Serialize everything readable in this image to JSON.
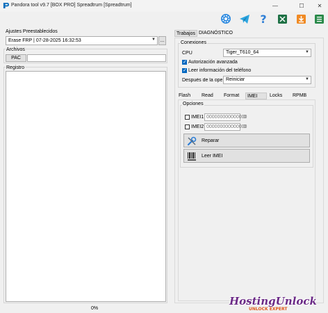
{
  "window": {
    "title": "Pandora tool v9.7 [BOX PRO] Spreadtrum [Spreadtrum]",
    "minimize": "—",
    "maximize": "☐",
    "close": "✕"
  },
  "toolbar": {
    "icons": [
      "gear-icon",
      "telegram-icon",
      "help-icon",
      "excel-icon",
      "download-icon",
      "menu-icon"
    ]
  },
  "left": {
    "presets_label": "Ajustes Preestablecidos",
    "preset_value": "Erase FRP | 07-28-2025 16:32:53",
    "preset_button": "...",
    "files_label": "Archivos",
    "pac_button": "PAC",
    "log_label": "Registro",
    "progress": "0%"
  },
  "right": {
    "tabs": [
      "Trabajos",
      "DIAGNÓSTICO"
    ],
    "connections_label": "Conexiones",
    "cpu_label": "CPU",
    "cpu_value": "Tiger_T610_64",
    "auto_auth_label": "Autorización avanzada",
    "read_phone_info_label": "Leer información del teléfono",
    "after_op_label": "Después de la operac",
    "after_op_value": "Reiniciar",
    "subtabs": [
      "Flash",
      "Read",
      "Format",
      "IMEI",
      "Locks",
      "RPMB"
    ],
    "options_label": "Opciones",
    "imei1_label": "IMEI1",
    "imei1_value": "000000000000000",
    "imei1_count": "0",
    "imei2_label": "IMEI2",
    "imei2_value": "000000000000000",
    "imei2_count": "0",
    "repair_button": "Reparar",
    "read_imei_button": "Leer IMEI"
  },
  "watermark": {
    "main": "HostingUnlock",
    "sub": "UNLOCK EXPERT"
  },
  "colors": {
    "accent_blue": "#0067c0",
    "telegram": "#2ca5e0",
    "excel": "#1e7145",
    "download": "#f08a24"
  }
}
